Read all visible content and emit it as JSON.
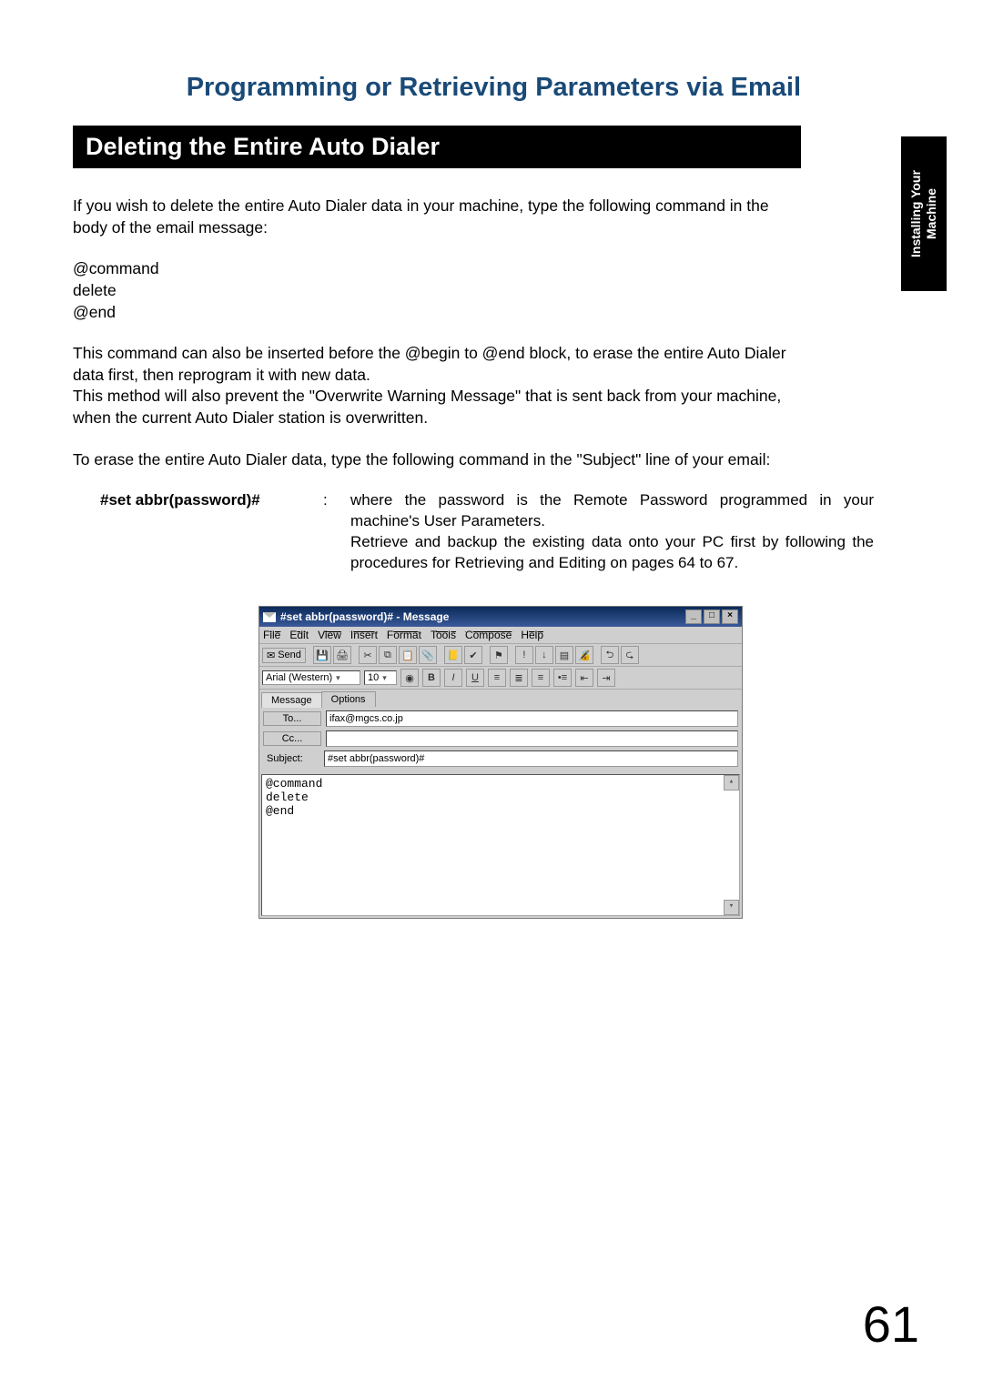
{
  "chapter_title": "Programming or Retrieving Parameters via Email",
  "section_title": "Deleting the Entire Auto Dialer",
  "side_tab": "Installing Your\nMachine",
  "intro_paragraph": "If you wish to delete the entire Auto Dialer data in your machine, type the following command in the body of the email message:",
  "command_block": "@command\ndelete\n@end",
  "explain1": "This command can also be inserted before the @begin to @end block, to erase the entire Auto Dialer data first, then reprogram it with new data.",
  "explain2": "This method will also prevent the \"Overwrite Warning Message\" that is sent back from your machine, when the current Auto Dialer station is overwritten.",
  "explain3": "To erase the entire Auto Dialer data, type the following command in the \"Subject\" line of your email:",
  "def_term": "#set abbr(password)#",
  "def_colon": ":",
  "def_desc": "where the password is the Remote Password programmed in your machine's User Parameters.\nRetrieve and backup the existing data onto your PC first by following the procedures for Retrieving and Editing on pages 64 to 67.",
  "email_window": {
    "title": "#set abbr(password)# - Message",
    "menu": [
      "File",
      "Edit",
      "View",
      "Insert",
      "Format",
      "Tools",
      "Compose",
      "Help"
    ],
    "send_label": "Send",
    "font_name": "Arial (Western)",
    "font_size": "10",
    "tab_message": "Message",
    "tab_options": "Options",
    "to_label": "To...",
    "cc_label": "Cc...",
    "subject_label": "Subject:",
    "to_value": "ifax@mgcs.co.jp",
    "cc_value": "",
    "subject_value": "#set abbr(password)#",
    "body": "@command\ndelete\n@end"
  },
  "page_number": "61"
}
